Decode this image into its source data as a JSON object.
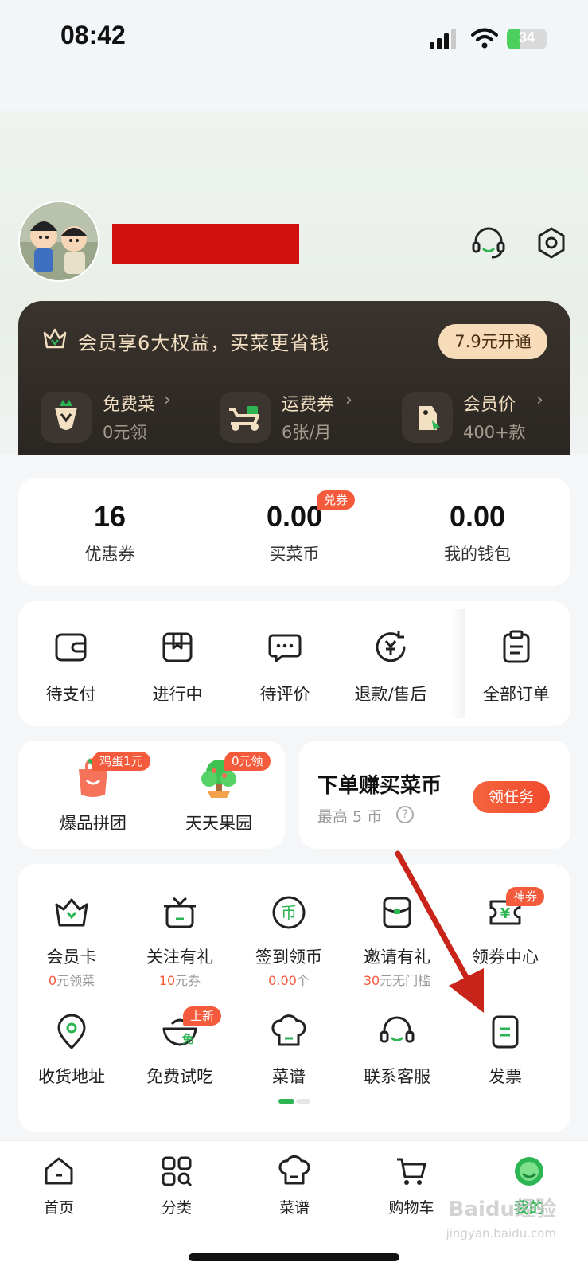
{
  "status_bar": {
    "time": "08:42",
    "battery": "34",
    "battery_level": 0.34
  },
  "vip": {
    "headline": "会员享6大权益，买菜更省钱",
    "open_button": "7.9元开通",
    "perks": [
      {
        "title": "免费菜",
        "sub": "0元领",
        "icon": "radish-icon"
      },
      {
        "title": "运费券",
        "sub": "6张/月",
        "icon": "scooter-icon"
      },
      {
        "title": "会员价",
        "sub": "400+款",
        "icon": "price-tag-icon"
      }
    ],
    "arrow": "›"
  },
  "stats": [
    {
      "value": "16",
      "label": "优惠券"
    },
    {
      "value": "0.00",
      "label": "买菜币",
      "badge": "兑券"
    },
    {
      "value": "0.00",
      "label": "我的钱包"
    }
  ],
  "orders": [
    {
      "label": "待支付",
      "icon": "wallet-icon"
    },
    {
      "label": "进行中",
      "icon": "package-icon"
    },
    {
      "label": "待评价",
      "icon": "comment-icon"
    },
    {
      "label": "退款/售后",
      "icon": "refund-icon"
    },
    {
      "label": "全部订单",
      "icon": "clipboard-icon"
    }
  ],
  "promos": [
    {
      "label": "爆品拼团",
      "badge": "鸡蛋1元",
      "icon": "shopping-bag-icon"
    },
    {
      "label": "天天果园",
      "badge": "0元领",
      "icon": "fruit-tree-icon"
    }
  ],
  "task": {
    "title": "下单赚买菜币",
    "sub": "最高 5 币",
    "help": "?",
    "button": "领任务"
  },
  "services": [
    {
      "label": "会员卡",
      "sub_red": "0",
      "sub": "元领菜",
      "icon": "member-card-icon"
    },
    {
      "label": "关注有礼",
      "sub_red": "10",
      "sub": "元券",
      "icon": "gift-box-icon"
    },
    {
      "label": "签到领币",
      "sub_red": "0.00",
      "sub": "个",
      "icon": "coin-icon",
      "coin_char": "币"
    },
    {
      "label": "邀请有礼",
      "sub_red": "30",
      "sub": "元无门槛",
      "icon": "invite-envelope-icon"
    },
    {
      "label": "领券中心",
      "badge": "神券",
      "icon": "coupon-icon",
      "coupon_char": "¥"
    },
    {
      "label": "收货地址",
      "icon": "location-pin-icon"
    },
    {
      "label": "免费试吃",
      "badge": "上新",
      "icon": "free-tasting-icon",
      "free_char": "免"
    },
    {
      "label": "菜谱",
      "icon": "chef-hat-icon"
    },
    {
      "label": "联系客服",
      "icon": "headset-icon"
    },
    {
      "label": "发票",
      "icon": "invoice-icon"
    }
  ],
  "bottom_nav": [
    {
      "label": "首页",
      "icon": "home-icon"
    },
    {
      "label": "分类",
      "icon": "category-grid-icon"
    },
    {
      "label": "菜谱",
      "icon": "chef-hat-icon"
    },
    {
      "label": "购物车",
      "icon": "cart-icon"
    },
    {
      "label": "我的",
      "icon": "profile-icon",
      "active": true
    }
  ],
  "watermark": {
    "logo": "Baidu经验",
    "url": "jingyan.baidu.com"
  },
  "colors": {
    "accent_green": "#2db553",
    "badge_red": "#f45a3c",
    "vip_dark": "#2e2925",
    "vip_gold": "#f3dfc2",
    "redaction": "#d0100c",
    "arrow_red": "#c8241a"
  }
}
